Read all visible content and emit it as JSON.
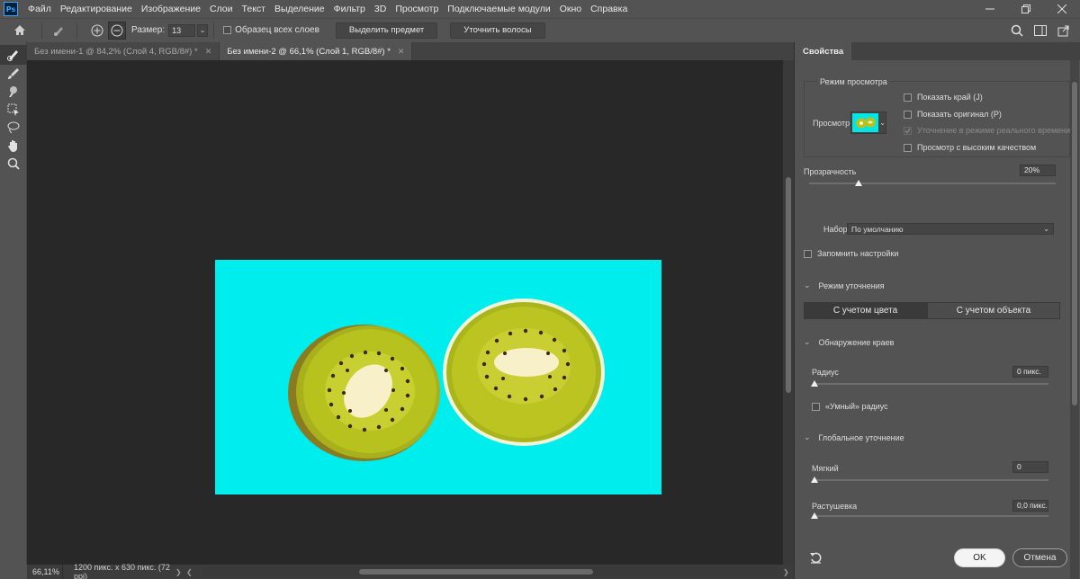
{
  "app": {
    "logo_text": "Ps"
  },
  "menu": [
    "Файл",
    "Редактирование",
    "Изображение",
    "Слои",
    "Текст",
    "Выделение",
    "Фильтр",
    "3D",
    "Просмотр",
    "Подключаемые модули",
    "Окно",
    "Справка"
  ],
  "options_bar": {
    "size_label": "Размер:",
    "size_value": "13",
    "sample_all_layers": "Образец всех слоев",
    "select_subject": "Выделить предмет",
    "refine_hair": "Уточнить волосы"
  },
  "tabs": [
    {
      "label": "Без имени-1 @ 84,2% (Слой 4, RGB/8#) *",
      "active": false
    },
    {
      "label": "Без имени-2 @ 66,1% (Слой 1, RGB/8#) *",
      "active": true
    }
  ],
  "status": {
    "zoom": "66,11%",
    "doc_info": "1200 пикс. x 630 пикс. (72 ppi)"
  },
  "canvas": {
    "image_background": "#00eeee",
    "kiwi_flesh": "#b8c21e",
    "kiwi_core": "#f7f0c8"
  },
  "panel": {
    "tab": "Свойства",
    "view_mode": {
      "group_label": "Режим просмотра",
      "preview_label": "Просмотр",
      "show_edge": "Показать край (J)",
      "show_original": "Показать оригинал (P)",
      "realtime_refine": "Уточнение в режиме реального времени",
      "high_quality": "Просмотр с высоким качеством"
    },
    "transparency": {
      "label": "Прозрачность",
      "value": "20%",
      "level": 0.2
    },
    "preset": {
      "label": "Набор",
      "value": "По умолчанию"
    },
    "remember_settings": "Запомнить настройки",
    "refine_mode": {
      "label": "Режим уточнения",
      "options": [
        "С учетом цвета",
        "С учетом объекта"
      ],
      "selected": 0
    },
    "edge_detection": {
      "label": "Обнаружение краев",
      "radius_label": "Радиус",
      "radius_value": "0 пикс.",
      "smart_radius": "«Умный» радиус"
    },
    "global_refine": {
      "label": "Глобальное уточнение",
      "smooth_label": "Мягкий",
      "smooth_value": "0",
      "feather_label": "Растушевка",
      "feather_value": "0,0 пикс."
    },
    "ok": "OK",
    "cancel": "Отмена"
  }
}
